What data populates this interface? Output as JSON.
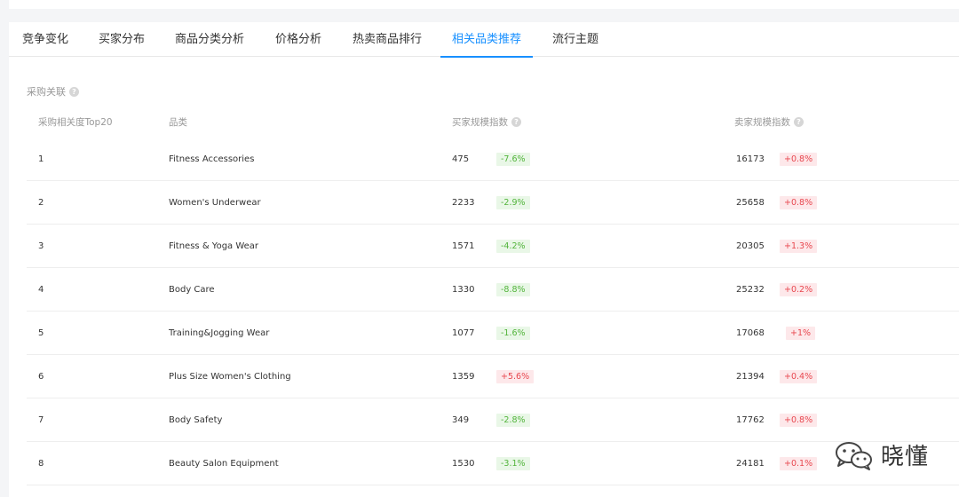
{
  "tabs": [
    {
      "label": "竞争变化",
      "active": false
    },
    {
      "label": "买家分布",
      "active": false
    },
    {
      "label": "商品分类分析",
      "active": false
    },
    {
      "label": "价格分析",
      "active": false
    },
    {
      "label": "热卖商品排行",
      "active": false
    },
    {
      "label": "相关品类推荐",
      "active": true
    },
    {
      "label": "流行主题",
      "active": false
    }
  ],
  "section": {
    "title": "采购关联"
  },
  "table": {
    "columns": [
      "采购相关度Top20",
      "品类",
      "买家规模指数",
      "卖家规模指数"
    ],
    "rows": [
      {
        "rank": "1",
        "category": "Fitness Accessories",
        "buyer_index": "475",
        "buyer_change": "-7.6%",
        "buyer_dir": "down",
        "seller_index": "16173",
        "seller_change": "+0.8%",
        "seller_dir": "up"
      },
      {
        "rank": "2",
        "category": "Women's Underwear",
        "buyer_index": "2233",
        "buyer_change": "-2.9%",
        "buyer_dir": "down",
        "seller_index": "25658",
        "seller_change": "+0.8%",
        "seller_dir": "up"
      },
      {
        "rank": "3",
        "category": "Fitness & Yoga Wear",
        "buyer_index": "1571",
        "buyer_change": "-4.2%",
        "buyer_dir": "down",
        "seller_index": "20305",
        "seller_change": "+1.3%",
        "seller_dir": "up"
      },
      {
        "rank": "4",
        "category": "Body Care",
        "buyer_index": "1330",
        "buyer_change": "-8.8%",
        "buyer_dir": "down",
        "seller_index": "25232",
        "seller_change": "+0.2%",
        "seller_dir": "up"
      },
      {
        "rank": "5",
        "category": "Training&Jogging Wear",
        "buyer_index": "1077",
        "buyer_change": "-1.6%",
        "buyer_dir": "down",
        "seller_index": "17068",
        "seller_change": "+1%",
        "seller_dir": "up"
      },
      {
        "rank": "6",
        "category": "Plus Size Women's Clothing",
        "buyer_index": "1359",
        "buyer_change": "+5.6%",
        "buyer_dir": "up",
        "seller_index": "21394",
        "seller_change": "+0.4%",
        "seller_dir": "up"
      },
      {
        "rank": "7",
        "category": "Body Safety",
        "buyer_index": "349",
        "buyer_change": "-2.8%",
        "buyer_dir": "down",
        "seller_index": "17762",
        "seller_change": "+0.8%",
        "seller_dir": "up"
      },
      {
        "rank": "8",
        "category": "Beauty Salon Equipment",
        "buyer_index": "1530",
        "buyer_change": "-3.1%",
        "buyer_dir": "down",
        "seller_index": "24181",
        "seller_change": "+0.1%",
        "seller_dir": "up"
      }
    ]
  },
  "icons": {
    "help": "question-circle-icon",
    "wechat": "wechat-logo-icon"
  },
  "colors": {
    "accent": "#1890ff",
    "up": "#e8474f",
    "up_bg": "#fde8ea",
    "down": "#52b43b",
    "down_bg": "#e9f7e7"
  },
  "watermark": {
    "text": "晓懂"
  }
}
